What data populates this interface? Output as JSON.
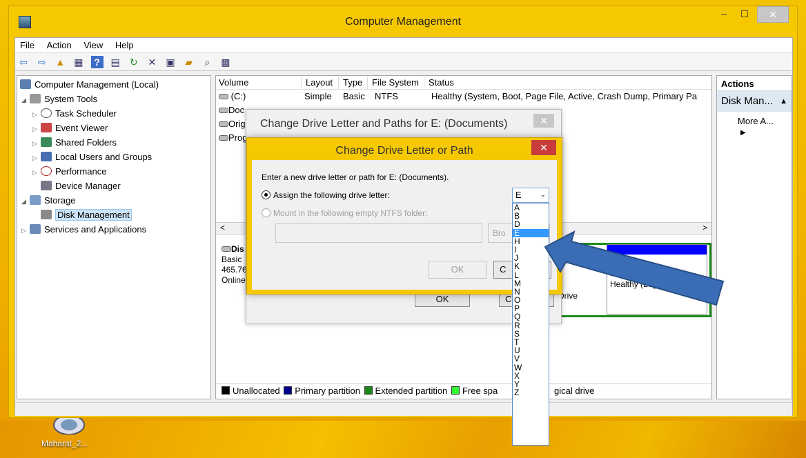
{
  "window": {
    "title": "Computer Management",
    "min": "–",
    "max": "☐",
    "close": "✕"
  },
  "menu": [
    "File",
    "Action",
    "View",
    "Help"
  ],
  "tree": {
    "root": "Computer Management (Local)",
    "system_tools": "System Tools",
    "task_scheduler": "Task Scheduler",
    "event_viewer": "Event Viewer",
    "shared_folders": "Shared Folders",
    "local_users": "Local Users and Groups",
    "performance": "Performance",
    "device_manager": "Device Manager",
    "storage": "Storage",
    "disk_management": "Disk Management",
    "services": "Services and Applications"
  },
  "volumes": {
    "headers": [
      "Volume",
      "Layout",
      "Type",
      "File System",
      "Status"
    ],
    "row1": {
      "volume": "(C:)",
      "layout": "Simple",
      "type": "Basic",
      "fs": "NTFS",
      "status": "Healthy (System, Boot, Page File, Active, Crash Dump, Primary Pa"
    },
    "row2": {
      "volume": "Doc"
    },
    "row3": {
      "volume": "Orig"
    },
    "row4": {
      "volume": "Prog"
    }
  },
  "disk": {
    "name": "Dis",
    "type": "Basic",
    "size": "465.76",
    "state": "Online",
    "part_right_size": "165.76 GB N",
    "part_right_status": "Healthy (Logical Drive",
    "part_mid_status": "l Drive"
  },
  "legend": {
    "unallocated": "Unallocated",
    "primary": "Primary partition",
    "extended": "Extended partition",
    "free": "Free spa",
    "logical": "gical drive"
  },
  "actions": {
    "header": "Actions",
    "sub": "Disk Man...",
    "more": "More A..."
  },
  "dialog_back": {
    "title": "Change Drive Letter and Paths for E: (Documents)",
    "close": "✕",
    "ok": "OK",
    "cancel": "Ca"
  },
  "dialog_front": {
    "title": "Change Drive Letter or Path",
    "close": "✕",
    "prompt": "Enter a new drive letter or path for E: (Documents).",
    "assign_label": "Assign the following drive letter:",
    "mount_label": "Mount in the following empty NTFS folder:",
    "browse": "Bro",
    "ok": "OK",
    "cancel": "C"
  },
  "drive_letter": {
    "selected": "E",
    "options": [
      "A",
      "B",
      "D",
      "E",
      "H",
      "I",
      "J",
      "K",
      "L",
      "M",
      "N",
      "O",
      "P",
      "Q",
      "R",
      "S",
      "T",
      "U",
      "V",
      "W",
      "X",
      "Y",
      "Z"
    ]
  },
  "desktop": {
    "icon_label": "Maharat_2..."
  },
  "colors": {
    "accent": "#f6c800",
    "selection": "#3399ff",
    "primary_partition": "#00008b",
    "extended_partition": "#1a8a1a",
    "free_space": "#33ff33",
    "arrow": "#3a6db5"
  }
}
